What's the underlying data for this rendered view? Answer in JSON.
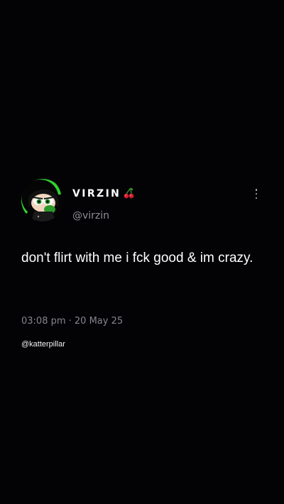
{
  "tweet": {
    "display_name": "VIRZIN",
    "name_emoji_icon": "cherry-icon",
    "handle": "@virzin",
    "text": "don't flirt with me i fck good & im crazy.",
    "timestamp": "03:08 pm · 20 May 25",
    "more_icon": "vertical-ellipsis-icon"
  },
  "watermark": "@katterpillar",
  "colors": {
    "background": "#030306",
    "text": "#ffffff",
    "secondary_text": "#8e9096",
    "avatar_accent": "#2fd12f",
    "cherry": "#d41c2c"
  }
}
